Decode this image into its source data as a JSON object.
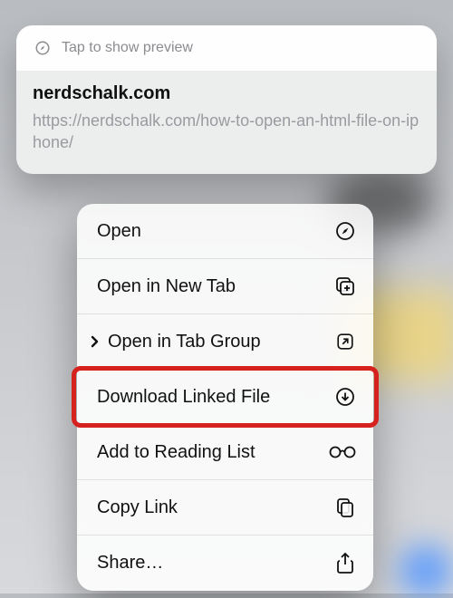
{
  "preview": {
    "hint": "Tap to show preview",
    "domain": "nerdschalk.com",
    "url": "https://nerdschalk.com/how-to-open-an-html-file-on-iphone/"
  },
  "menu": {
    "items": [
      {
        "label": "Open",
        "icon": "compass-icon",
        "chevron": false
      },
      {
        "label": "Open in New Tab",
        "icon": "plus-square-icon",
        "chevron": false
      },
      {
        "label": "Open in Tab Group",
        "icon": "arrow-box-icon",
        "chevron": true
      },
      {
        "label": "Download Linked File",
        "icon": "download-icon",
        "chevron": false,
        "highlighted": true
      },
      {
        "label": "Add to Reading List",
        "icon": "glasses-icon",
        "chevron": false
      },
      {
        "label": "Copy Link",
        "icon": "copy-icon",
        "chevron": false
      },
      {
        "label": "Share…",
        "icon": "share-icon",
        "chevron": false
      }
    ]
  }
}
